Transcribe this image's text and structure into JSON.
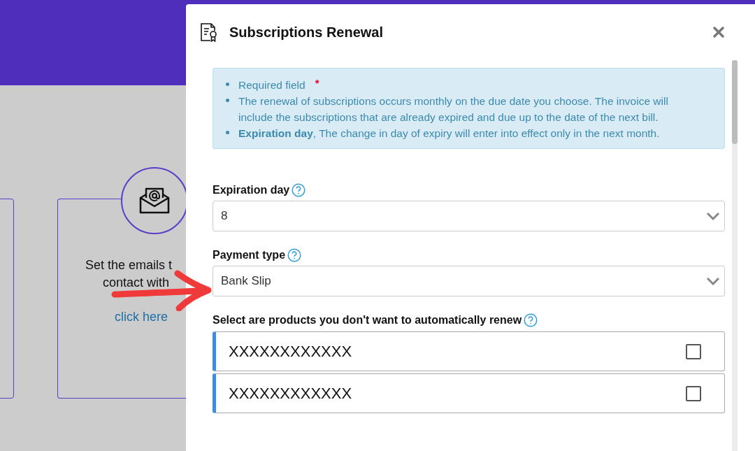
{
  "background_card": {
    "text_lines": [
      "Set the emails t",
      "contact with"
    ],
    "link": "click here"
  },
  "modal": {
    "title": "Subscriptions Renewal",
    "notes": [
      {
        "text": "Required field",
        "required_mark": "*"
      },
      {
        "text": "The renewal of subscriptions occurs monthly on the due date you choose. The invoice will include the subscriptions that are already expired and due up to the date of the next bill."
      },
      {
        "text": "**Expiration day**, The change in day of expiry will enter into effect only in the next month."
      }
    ],
    "fields": [
      {
        "label": "Expiration day",
        "value": "8"
      },
      {
        "label": "Payment type",
        "value": "Bank Slip"
      }
    ],
    "products": {
      "label": "Select are products you don't want to automatically renew",
      "items": [
        {
          "name": "XXXXXXXXXXXX",
          "checked": false
        },
        {
          "name": "XXXXXXXXXXXX",
          "checked": false
        }
      ]
    }
  }
}
